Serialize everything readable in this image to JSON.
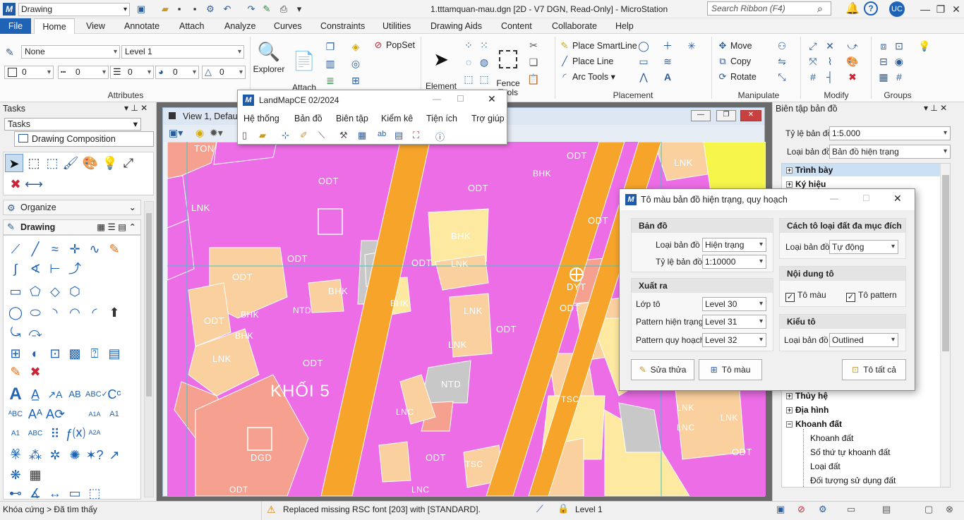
{
  "titlebar": {
    "workspace": "Drawing",
    "title": "1.tttamquan-mau.dgn [2D - V7 DGN, Read-Only] - MicroStation",
    "search_placeholder": "Search Ribbon (F4)",
    "user": "UC"
  },
  "menu": [
    "File",
    "Home",
    "View",
    "Annotate",
    "Attach",
    "Analyze",
    "Curves",
    "Constraints",
    "Utilities",
    "Drawing Aids",
    "Content",
    "Collaborate",
    "Help"
  ],
  "ribbon": {
    "attributes": {
      "color": "None",
      "level": "Level 1",
      "weight1": "0",
      "style": "0",
      "weight2": "0",
      "trans": "0",
      "prio": "0",
      "label": "Attributes"
    },
    "explorer": "Explorer",
    "attach_tools": "Attach\nTools",
    "popset": "PopSet",
    "element_selection": "Element\nSelection",
    "fence_tools": "Fence\nTools",
    "place_smartline": "Place SmartLine",
    "place_line": "Place Line",
    "arc_tools": "Arc Tools",
    "placement_label": "Placement",
    "move": "Move",
    "copy": "Copy",
    "rotate": "Rotate",
    "manipulate_label": "Manipulate",
    "modify_label": "Modify",
    "groups_label": "Groups"
  },
  "tasks": {
    "title": "Tasks",
    "dropdown": "Tasks",
    "composition": "Drawing Composition",
    "organize": "Organize",
    "drawing": "Drawing"
  },
  "view": {
    "title": "View 1, Default"
  },
  "landmap": {
    "title": "LandMapCE 02/2024",
    "menu": [
      "Hệ thống",
      "Bản đồ",
      "Biên tập",
      "Kiểm kê",
      "Tiện ích",
      "Trợ giúp"
    ]
  },
  "map_labels": {
    "ton": "TON",
    "odt": "ODT",
    "lnk": "LNK",
    "bhk": "BHK",
    "lnc": "LNC",
    "ntd": "NTD",
    "dyt": "DYT",
    "dgd": "DGD",
    "tsc": "TSC",
    "khoi": "KHỐI 5"
  },
  "dialog": {
    "title": "Tô màu bản đồ hiện trạng, quy hoạch",
    "ban_do": {
      "head": "Bản đồ",
      "loai_label": "Loại bản đồ",
      "loai_value": "Hiện trạng",
      "tyle_label": "Tỷ lệ bản đồ",
      "tyle_value": "1:10000"
    },
    "xuat_ra": {
      "head": "Xuất ra",
      "lopto_label": "Lớp tô",
      "lopto_value": "Level 30",
      "pht_label": "Pattern hiện trạng",
      "pht_value": "Level 31",
      "pqh_label": "Pattern quy hoạch",
      "pqh_value": "Level 32"
    },
    "cach_to": {
      "head": "Cách tô loại đất đa mục đích",
      "loai_label": "Loại bản đồ",
      "loai_value": "Tự động"
    },
    "noi_dung": {
      "head": "Nội dung tô",
      "to_mau": "Tô màu",
      "to_pattern": "Tô pattern"
    },
    "kieu_to": {
      "head": "Kiểu tô",
      "loai_label": "Loại bản đồ",
      "loai_value": "Outlined"
    },
    "buttons": {
      "sua_thua": "Sửa thửa",
      "to_mau": "Tô màu",
      "to_tat_ca": "Tô tất cả"
    }
  },
  "rpanel": {
    "title": "Biên tập bản đồ",
    "tyle_label": "Tỷ lệ bản đồ",
    "tyle_value": "1:5.000",
    "loai_label": "Loại bản đồ",
    "loai_value": "Bản đồ hiện trạng",
    "tree": {
      "trinh_bay": "Trình bày",
      "ky_hieu": "Ký hiệu",
      "thuy_he": "Thủy hệ",
      "dia_hinh": "Địa hình",
      "khoanh_dat": "Khoanh đất",
      "children": [
        "Khoanh đất",
        "Số thứ tự khoanh đất",
        "Loại đất",
        "Đối tượng sử dụng đất"
      ]
    }
  },
  "status": {
    "left": "Khóa cứng > Đã tìm thấy",
    "message": "Replaced missing RSC font [203] with [STANDARD].",
    "level": "Level 1"
  }
}
